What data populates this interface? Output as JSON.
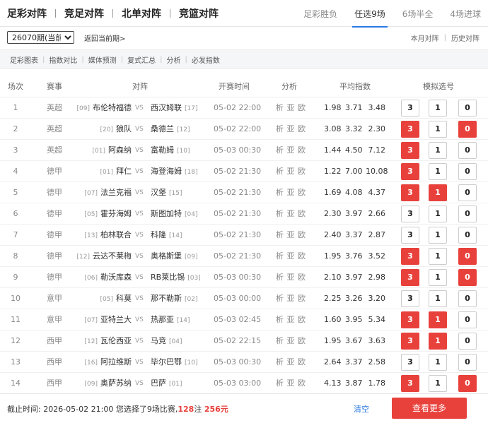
{
  "main_tabs": [
    "足彩对阵",
    "竞足对阵",
    "北单对阵",
    "竞篮对阵"
  ],
  "sub_tabs": [
    {
      "label": "足彩胜负",
      "active": false
    },
    {
      "label": "任选9场",
      "active": true
    },
    {
      "label": "6场半全",
      "active": false
    },
    {
      "label": "4场进球",
      "active": false
    }
  ],
  "issue": {
    "selected": "26070期(当前期)",
    "back_link": "返回当前期>",
    "month_link": "本月对阵",
    "history_link": "历史对阵"
  },
  "toolbar": [
    "足彩图表",
    "指数对比",
    "媒体预测",
    "复式汇总",
    "分析",
    "必发指数"
  ],
  "columns": {
    "index": "场次",
    "league": "赛事",
    "match": "对阵",
    "time": "开赛时间",
    "analysis": "分析",
    "odds": "平均指数",
    "picks": "模拟选号"
  },
  "pick_labels": [
    "3",
    "1",
    "0"
  ],
  "vs_label": "VS",
  "analysis_label": "析 亚 欧",
  "matches": [
    {
      "idx": "1",
      "league": "英超",
      "home_rank": "[09]",
      "home": "布伦特福德",
      "away": "西汉姆联",
      "away_rank": "[17]",
      "time": "05-02 22:00",
      "odds": [
        "1.98",
        "3.71",
        "3.48"
      ],
      "picks": [
        false,
        false,
        false
      ]
    },
    {
      "idx": "2",
      "league": "英超",
      "home_rank": "[20]",
      "home": "狼队",
      "away": "桑德兰",
      "away_rank": "[12]",
      "time": "05-02 22:00",
      "odds": [
        "3.08",
        "3.32",
        "2.30"
      ],
      "picks": [
        true,
        false,
        true
      ]
    },
    {
      "idx": "3",
      "league": "英超",
      "home_rank": "[01]",
      "home": "阿森纳",
      "away": "富勒姆",
      "away_rank": "[10]",
      "time": "05-03 00:30",
      "odds": [
        "1.44",
        "4.50",
        "7.12"
      ],
      "picks": [
        true,
        false,
        false
      ]
    },
    {
      "idx": "4",
      "league": "德甲",
      "home_rank": "[01]",
      "home": "拜仁",
      "away": "海登海姆",
      "away_rank": "[18]",
      "time": "05-02 21:30",
      "odds": [
        "1.22",
        "7.00",
        "10.08"
      ],
      "picks": [
        true,
        false,
        false
      ]
    },
    {
      "idx": "5",
      "league": "德甲",
      "home_rank": "[07]",
      "home": "法兰克福",
      "away": "汉堡",
      "away_rank": "[15]",
      "time": "05-02 21:30",
      "odds": [
        "1.69",
        "4.08",
        "4.37"
      ],
      "picks": [
        true,
        true,
        false
      ]
    },
    {
      "idx": "6",
      "league": "德甲",
      "home_rank": "[05]",
      "home": "霍芬海姆",
      "away": "斯图加特",
      "away_rank": "[04]",
      "time": "05-02 21:30",
      "odds": [
        "2.30",
        "3.97",
        "2.66"
      ],
      "picks": [
        false,
        false,
        false
      ]
    },
    {
      "idx": "7",
      "league": "德甲",
      "home_rank": "[13]",
      "home": "柏林联合",
      "away": "科隆",
      "away_rank": "[14]",
      "time": "05-02 21:30",
      "odds": [
        "2.40",
        "3.37",
        "2.87"
      ],
      "picks": [
        false,
        false,
        false
      ]
    },
    {
      "idx": "8",
      "league": "德甲",
      "home_rank": "[12]",
      "home": "云达不莱梅",
      "away": "奥格斯堡",
      "away_rank": "[09]",
      "time": "05-02 21:30",
      "odds": [
        "1.95",
        "3.76",
        "3.52"
      ],
      "picks": [
        true,
        false,
        true
      ]
    },
    {
      "idx": "9",
      "league": "德甲",
      "home_rank": "[06]",
      "home": "勒沃库森",
      "away": "RB莱比锡",
      "away_rank": "[03]",
      "time": "05-03 00:30",
      "odds": [
        "2.10",
        "3.97",
        "2.98"
      ],
      "picks": [
        true,
        false,
        true
      ]
    },
    {
      "idx": "10",
      "league": "意甲",
      "home_rank": "[05]",
      "home": "科莫",
      "away": "那不勒斯",
      "away_rank": "[02]",
      "time": "05-03 00:00",
      "odds": [
        "2.25",
        "3.26",
        "3.20"
      ],
      "picks": [
        false,
        false,
        false
      ]
    },
    {
      "idx": "11",
      "league": "意甲",
      "home_rank": "[07]",
      "home": "亚特兰大",
      "away": "热那亚",
      "away_rank": "[14]",
      "time": "05-03 02:45",
      "odds": [
        "1.60",
        "3.95",
        "5.34"
      ],
      "picks": [
        true,
        true,
        false
      ]
    },
    {
      "idx": "12",
      "league": "西甲",
      "home_rank": "[12]",
      "home": "瓦伦西亚",
      "away": "马竞",
      "away_rank": "[04]",
      "time": "05-02 22:15",
      "odds": [
        "1.95",
        "3.67",
        "3.63"
      ],
      "picks": [
        true,
        true,
        false
      ]
    },
    {
      "idx": "13",
      "league": "西甲",
      "home_rank": "[16]",
      "home": "阿拉维斯",
      "away": "毕尔巴鄂",
      "away_rank": "[10]",
      "time": "05-03 00:30",
      "odds": [
        "2.64",
        "3.37",
        "2.58"
      ],
      "picks": [
        false,
        false,
        false
      ]
    },
    {
      "idx": "14",
      "league": "西甲",
      "home_rank": "[09]",
      "home": "奥萨苏纳",
      "away": "巴萨",
      "away_rank": "[01]",
      "time": "05-03 03:00",
      "odds": [
        "4.13",
        "3.87",
        "1.78"
      ],
      "picks": [
        true,
        false,
        true
      ]
    }
  ],
  "footer": {
    "deadline_label": "截止时间:",
    "deadline": "2026-05-02 21:00",
    "summary_prefix": "您选择了9场比赛,",
    "bets": "128",
    "bets_unit": "注",
    "amount": "256元",
    "clear_label": "清空",
    "more_label": "查看更多"
  },
  "colors": {
    "accent": "#e8413c",
    "link": "#2c7be5"
  }
}
